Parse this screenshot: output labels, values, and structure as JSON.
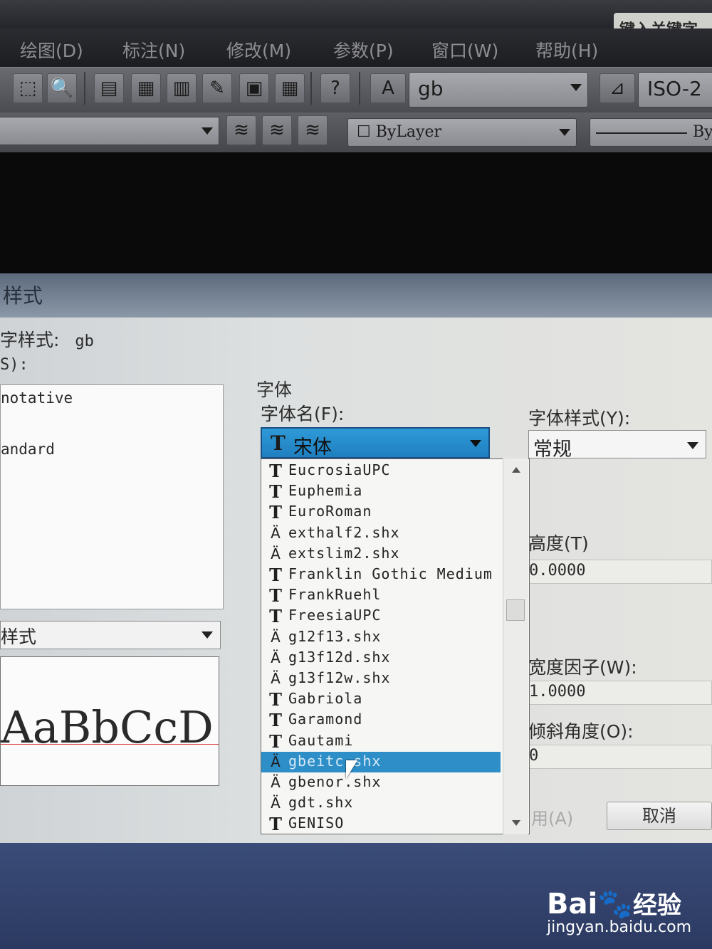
{
  "search": {
    "placeholder": "键入关键字"
  },
  "menu": [
    {
      "label": "绘图(D)"
    },
    {
      "label": "标注(N)"
    },
    {
      "label": "修改(M)"
    },
    {
      "label": "参数(P)"
    },
    {
      "label": "窗口(W)"
    },
    {
      "label": "帮助(H)"
    }
  ],
  "toolbar": {
    "text_style_combo": "gb",
    "dim_style_combo": "ISO-2",
    "layer_combo": "ByLayer",
    "linetype_combo": "By"
  },
  "dialog": {
    "title": "样式",
    "current_style_label": "字样式:",
    "current_style_value": "gb",
    "styles_label": "S):",
    "styles": [
      "notative",
      "andard"
    ],
    "filter_value": "样式",
    "preview_text": "AaBbCcD",
    "font_group_label": "字体",
    "font_name_label": "字体名(F):",
    "font_name_value": "宋体",
    "font_style_label": "字体样式(Y):",
    "font_style_value": "常规",
    "height_label": "高度(T)",
    "height_value": "0.0000",
    "width_factor_label": "宽度因子(W):",
    "width_factor_value": "1.0000",
    "oblique_label": "倾斜角度(O):",
    "oblique_value": "0",
    "apply_label": "用(A)",
    "cancel_label": "取消"
  },
  "font_list": [
    {
      "name": "EucrosiaUPC",
      "kind": "ttf"
    },
    {
      "name": "Euphemia",
      "kind": "ttf"
    },
    {
      "name": "EuroRoman",
      "kind": "ttf"
    },
    {
      "name": "exthalf2.shx",
      "kind": "shx"
    },
    {
      "name": "extslim2.shx",
      "kind": "shx"
    },
    {
      "name": "Franklin Gothic Medium",
      "kind": "ttf"
    },
    {
      "name": "FrankRuehl",
      "kind": "ttf"
    },
    {
      "name": "FreesiaUPC",
      "kind": "ttf"
    },
    {
      "name": "g12f13.shx",
      "kind": "shx"
    },
    {
      "name": "g13f12d.shx",
      "kind": "shx"
    },
    {
      "name": "g13f12w.shx",
      "kind": "shx"
    },
    {
      "name": "Gabriola",
      "kind": "ttf"
    },
    {
      "name": "Garamond",
      "kind": "ttf"
    },
    {
      "name": "Gautami",
      "kind": "ttf"
    },
    {
      "name": "gbeitc.shx",
      "kind": "shx",
      "selected": true
    },
    {
      "name": "gbenor.shx",
      "kind": "shx"
    },
    {
      "name": "gdt.shx",
      "kind": "shx"
    },
    {
      "name": "GENISO",
      "kind": "ttf"
    }
  ],
  "watermark": {
    "brand": "Bai",
    "brand2": "经验",
    "url": "jingyan.baidu.com"
  },
  "colors": {
    "selection": "#2e8fc8",
    "title_bar": "#6c7a8c",
    "dark_bg": "#0b0b0c"
  }
}
